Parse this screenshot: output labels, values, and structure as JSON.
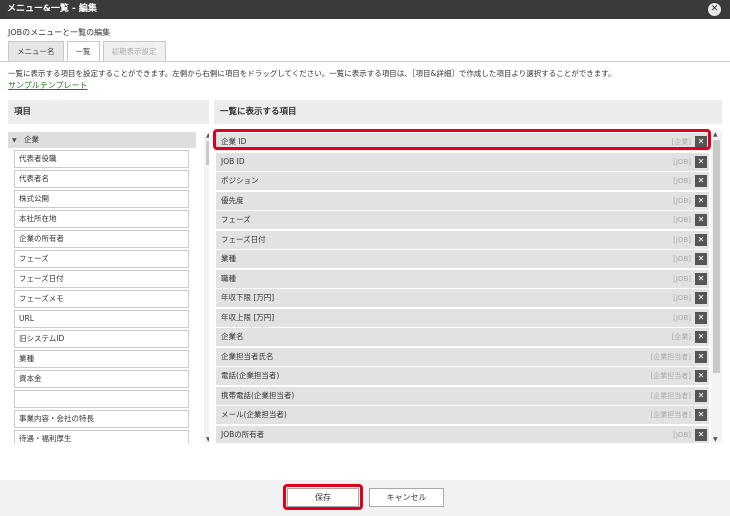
{
  "window": {
    "title": "メニュー&一覧 - 編集",
    "close_icon": "close-icon"
  },
  "subtitle": "JOBのメニューと一覧の編集",
  "tabs": [
    {
      "label": "メニュー名",
      "state": "normal"
    },
    {
      "label": "一覧",
      "state": "active"
    },
    {
      "label": "初期表示設定",
      "state": "disabled"
    }
  ],
  "description": "一覧に表示する項目を設定することができます。左側から右側に項目をドラッグしてください。一覧に表示する項目は、［項目&詳細］で作成した項目より選択することができます。",
  "sample_link": "サンプルテンプレート",
  "left_panel": {
    "header": "項目",
    "group": {
      "label": "企業",
      "icon": "chevron-down-icon"
    },
    "items": [
      "代表者役職",
      "代表者名",
      "株式公開",
      "本社所在地",
      "企業の所有者",
      "フェーズ",
      "フェーズ日付",
      "フェーズメモ",
      "URL",
      "旧システムID",
      "業種",
      "資本金",
      "",
      "事業内容・会社の特長",
      "待遇・福利厚生"
    ]
  },
  "right_panel": {
    "header": "一覧に表示する項目",
    "items": [
      {
        "label": "企業 ID",
        "tag": "[企業]"
      },
      {
        "label": "JOB ID",
        "tag": "[JOB]"
      },
      {
        "label": "ポジション",
        "tag": "[JOB]"
      },
      {
        "label": "優先度",
        "tag": "[JOB]"
      },
      {
        "label": "フェーズ",
        "tag": "[JOB]"
      },
      {
        "label": "フェーズ日付",
        "tag": "[JOB]"
      },
      {
        "label": "業種",
        "tag": "[JOB]"
      },
      {
        "label": "職種",
        "tag": "[JOB]"
      },
      {
        "label": "年収下限 [万円]",
        "tag": "[JOB]"
      },
      {
        "label": "年収上限 [万円]",
        "tag": "[JOB]"
      },
      {
        "label": "企業名",
        "tag": "[企業]"
      },
      {
        "label": "企業担当者氏名",
        "tag": "[企業担当者]"
      },
      {
        "label": "電話(企業担当者)",
        "tag": "[企業担当者]"
      },
      {
        "label": "携帯電話(企業担当者)",
        "tag": "[企業担当者]"
      },
      {
        "label": "メール(企業担当者)",
        "tag": "[企業担当者]"
      },
      {
        "label": "JOBの所有者",
        "tag": "[JOB]"
      }
    ],
    "delete_icon": "close-icon"
  },
  "footer": {
    "save_label": "保存",
    "cancel_label": "キャンセル"
  },
  "colors": {
    "titlebar": "#3a3a3a",
    "highlight": "#e0001a",
    "link": "#2a7a1e"
  }
}
